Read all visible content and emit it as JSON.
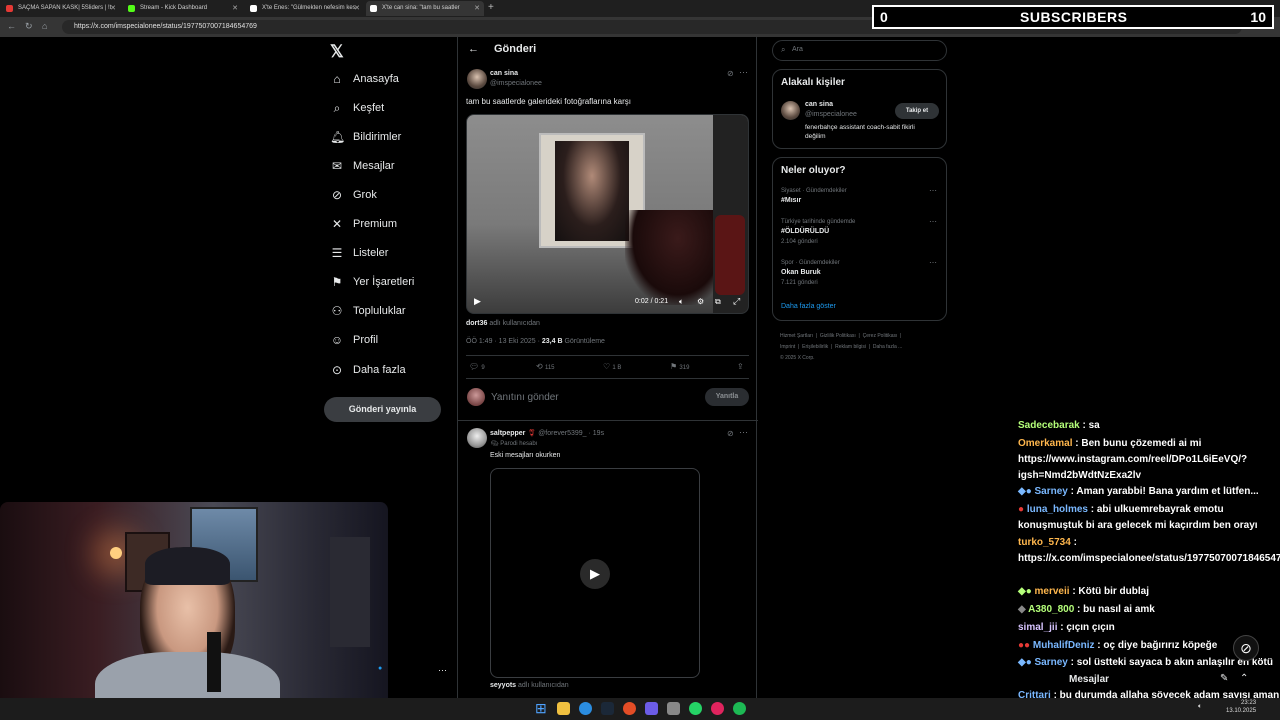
{
  "browser": {
    "tabs": [
      {
        "label": "SAÇMA SAPAN KASK| 5Sliders | !t",
        "color": "#e53935"
      },
      {
        "label": "Stream - Kick Dashboard",
        "color": "#53fc18"
      },
      {
        "label": "X'te Enes: \"Gülmekten nefesim kes",
        "color": "#ffffff"
      },
      {
        "label": "X'te can sina: \"tam bu saatler",
        "color": "#ffffff"
      }
    ],
    "new_tab": "+",
    "url": "https://x.com/imspecialonee/status/1977507007184654769"
  },
  "overlay": {
    "subs_count": "0",
    "subs_label": "SUBSCRIBERS",
    "subs_goal": "10"
  },
  "nav": {
    "items": [
      {
        "label": "Anasayfa",
        "icon": "⌂"
      },
      {
        "label": "Keşfet",
        "icon": "⌕"
      },
      {
        "label": "Bildirimler",
        "icon": "♫"
      },
      {
        "label": "Mesajlar",
        "icon": "✉"
      },
      {
        "label": "Grok",
        "icon": "⊘"
      },
      {
        "label": "Premium",
        "icon": "✕"
      },
      {
        "label": "Listeler",
        "icon": "☰"
      },
      {
        "label": "Yer İşaretleri",
        "icon": "⚑"
      },
      {
        "label": "Topluluklar",
        "icon": "⚇"
      },
      {
        "label": "Profil",
        "icon": "☺"
      },
      {
        "label": "Daha fazla",
        "icon": "⋯"
      }
    ],
    "post_button": "Gönderi yayınla"
  },
  "post": {
    "header": "Gönderi",
    "name": "can sina",
    "handle": "@imspecialonee",
    "text": "tam bu saatlerde galerideki fotoğraflarına karşı",
    "video_time": "0:02 / 0:21",
    "attribution_user": "dort36",
    "attribution_text": "adlı kullanıcıdan",
    "meta_time": "ÖÖ 1:49 · 13 Eki 2025 ·",
    "views": "23,4 B",
    "views_label": "Görüntüleme",
    "replies": "9",
    "reposts": "115",
    "likes": "1 B",
    "bookmarks": "319",
    "reply_placeholder": "Yanıtını gönder",
    "reply_button": "Yanıtla"
  },
  "reply": {
    "name": "saltpepper",
    "handle": "@forever5399_ · 19s",
    "parody": "Parodi hesabı",
    "text": "Eski mesajları okurken",
    "attribution_user": "seyyots",
    "attribution_text": "adlı kullanıcıdan"
  },
  "right": {
    "search_placeholder": "Ara",
    "related_title": "Alakalı kişiler",
    "related_name": "can sina",
    "related_handle": "@imspecialonee",
    "related_bio": "fenerbahçe assistant coach-sabit fikirli değilim",
    "follow_button": "Takip et",
    "trends_title": "Neler oluyor?",
    "trends": [
      {
        "context": "Siyaset · Gündemdekiler",
        "name": "#Mısır",
        "count": ""
      },
      {
        "context": "Türkiye tarihinde gündemde",
        "name": "#ÖLDÜRÜLDÜ",
        "count": "2.104 gönderi"
      },
      {
        "context": "Spor · Gündemdekiler",
        "name": "Okan Buruk",
        "count": "7.121 gönderi"
      }
    ],
    "show_more": "Daha fazla göster",
    "footer": [
      "Hizmet Şartları",
      "Gizlilik Politikası",
      "Çerez Politikası",
      "Imprint",
      "Erişilebilirlik",
      "Reklam bilgisi",
      "Daha fazla ...",
      "© 2025 X Corp."
    ]
  },
  "chat": [
    {
      "user": "Sadecebarak",
      "color": "#b5ff7a",
      "text": " : sa"
    },
    {
      "user": "Omerkamal",
      "color": "#ffb74d",
      "text": " : Ben bunu çözemedi ai mi https://www.instagram.com/reel/DPo1L6iEeVQ/?igsh=Nmd2bWdtNzExa2lv"
    },
    {
      "user": "Sarney",
      "color": "#7ab8ff",
      "text": " : Aman yarabbi! Bana yardım et lütfen..."
    },
    {
      "user": "luna_holmes",
      "color": "#7ab8ff",
      "text": " : abi ulkuemrebayrak emotu konuşmuştuk bi ara gelecek mi kaçırdım ben orayı"
    },
    {
      "user": "turko_5734",
      "color": "#ffb74d",
      "text": " : https://x.com/imspecialonee/status/1977507007184654769"
    },
    {
      "user": "merveii",
      "color": "#ffb74d",
      "text": " : Kötü bir dublaj"
    },
    {
      "user": "A380_800",
      "color": "#b5ff7a",
      "text": " : bu nasıl ai amk"
    },
    {
      "user": "simal_jii",
      "color": "#d7c4ff",
      "text": " : çıçın çıçın"
    },
    {
      "user": "MuhalifDeniz",
      "color": "#7ab8ff",
      "text": " : oç diye bağırırız köpeğe"
    },
    {
      "user": "Sarney",
      "color": "#7ab8ff",
      "text": " : sol üstteki sayaca b akın anlaşılır en kötü"
    },
    {
      "user": "Crittari",
      "color": "#7ab8ff",
      "text": " : bu durumda allaha sövecek adam sayısı aman allahım diyecek adam sayısından fazla"
    }
  ],
  "messages_label": "Mesajlar",
  "clock": {
    "time": "23:23",
    "date": "13.10.2025"
  }
}
